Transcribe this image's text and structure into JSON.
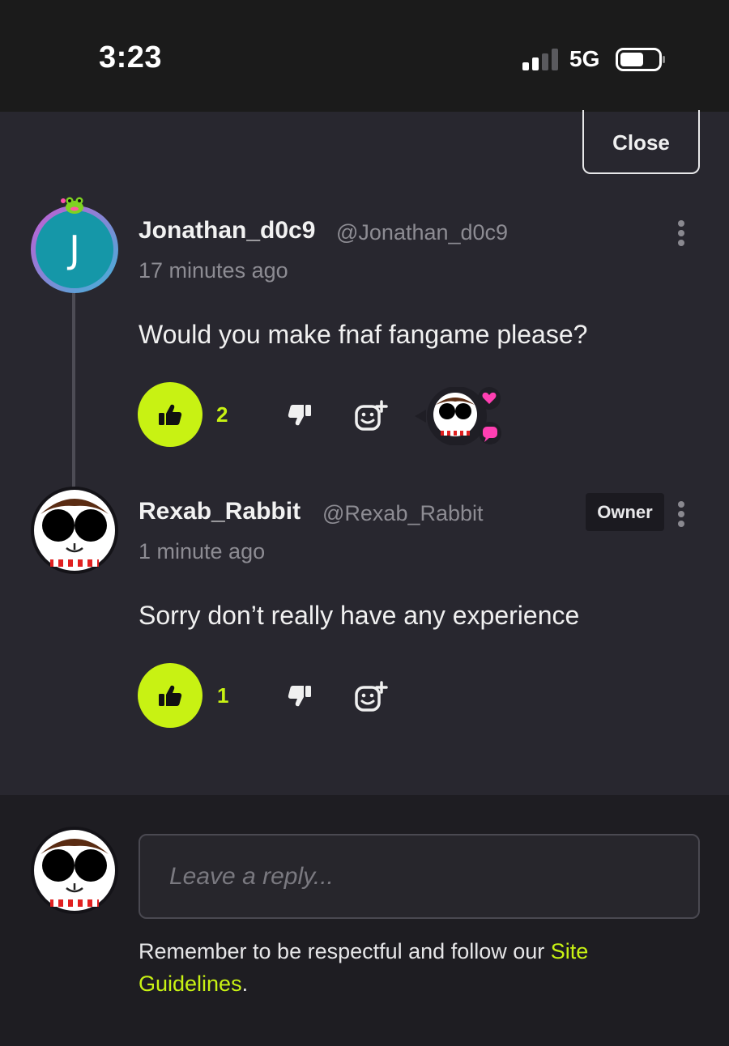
{
  "status_bar": {
    "time": "3:23",
    "network": "5G"
  },
  "close_label": "Close",
  "comments": [
    {
      "avatar_letter": "J",
      "username": "Jonathan_d0c9",
      "handle": "@Jonathan_d0c9",
      "time": "17 minutes ago",
      "text": "Would you make fnaf fangame please?",
      "likes": "2"
    },
    {
      "username": "Rexab_Rabbit",
      "handle": "@Rexab_Rabbit",
      "badge": "Owner",
      "time": "1 minute ago",
      "text": "Sorry don’t really have any experience",
      "likes": "1"
    }
  ],
  "reply": {
    "placeholder": "Leave a reply...",
    "note_prefix": "Remember to be respectful and follow our ",
    "link_text": "Site Guidelines",
    "note_suffix": "."
  },
  "colors": {
    "accent": "#c8f213",
    "panel": "#28272f",
    "footer": "#1e1d22",
    "reaction_pink": "#ff3fb2"
  }
}
